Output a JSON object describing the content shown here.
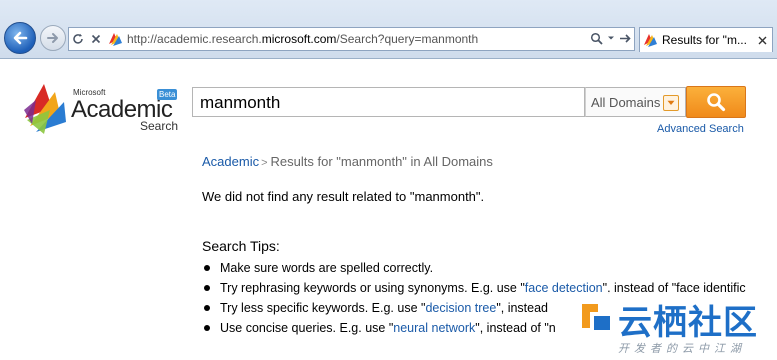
{
  "browser": {
    "url_prefix": "http://academic.research.",
    "url_host": "microsoft.com",
    "url_path": "/Search?query=manmonth",
    "tab_title": "Results for \"m...",
    "refresh_icon": "refresh-icon",
    "stop_icon": "stop-icon"
  },
  "logo": {
    "brand_small": "Microsoft",
    "name": "Academic",
    "badge": "Beta",
    "sub": "Search"
  },
  "search": {
    "query": "manmonth",
    "scope": "All Domains",
    "advanced_link": "Advanced Search"
  },
  "breadcrumb": {
    "root": "Academic",
    "separator": ">",
    "current": "Results for \"manmonth\" in All Domains"
  },
  "message": "We did not find any result related to \"manmonth\".",
  "tips": {
    "title": "Search Tips:",
    "items": [
      {
        "pre": "Make sure words are spelled correctly.",
        "link": "",
        "post": ""
      },
      {
        "pre": "Try rephrasing keywords or using synonyms. E.g. use \"",
        "link": "face detection",
        "post": "\", instead of \"face identific"
      },
      {
        "pre": "Try less specific keywords. E.g. use \"",
        "link": "decision tree",
        "post": "\", instead"
      },
      {
        "pre": "Use concise queries. E.g. use \"",
        "link": "neural network",
        "post": "\", instead of \"n"
      }
    ]
  },
  "watermark": {
    "title": "云栖社区",
    "sub": "开发者的云中江湖"
  },
  "colors": {
    "link": "#1a5aa8",
    "search_button": "#f39a1f"
  }
}
